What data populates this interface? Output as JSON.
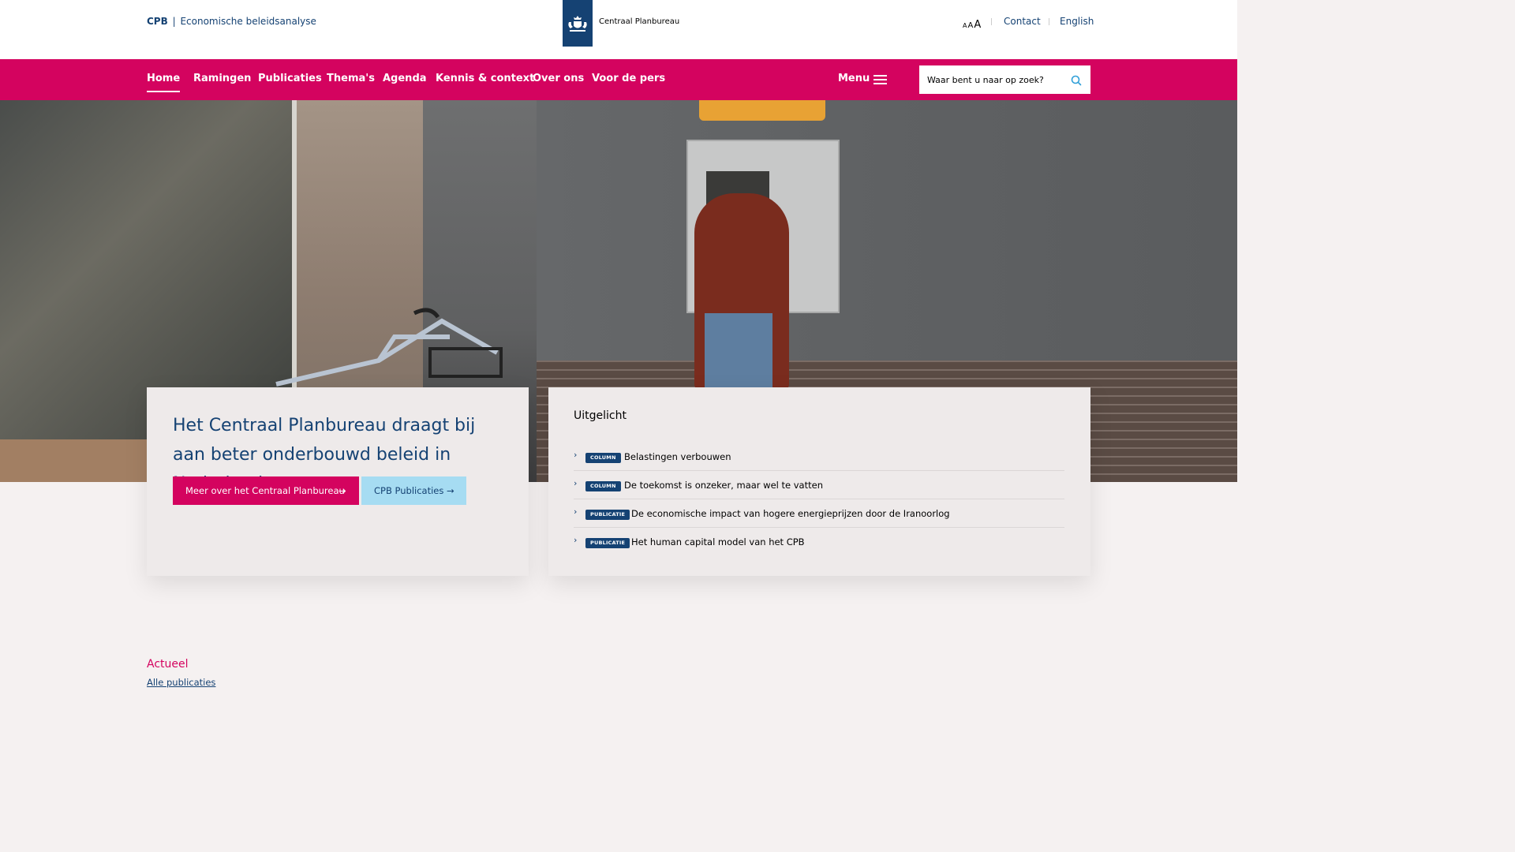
{
  "header": {
    "brand_short": "CPB",
    "brand_separator": "|",
    "brand_tagline": "Economische beleidsanalyse",
    "logo_text": "Centraal Planbureau",
    "font_size_labels": [
      "A",
      "A",
      "A"
    ],
    "contact_label": "Contact",
    "language_label": "English"
  },
  "nav": {
    "items": [
      {
        "label": "Home",
        "active": true
      },
      {
        "label": "Ramingen"
      },
      {
        "label": "Publicaties"
      },
      {
        "label": "Thema's"
      },
      {
        "label": "Agenda"
      },
      {
        "label": "Kennis & context"
      },
      {
        "label": "Over ons"
      },
      {
        "label": "Voor de pers"
      }
    ],
    "menu_label": "Menu",
    "search_placeholder": "Waar bent u naar op zoek?"
  },
  "intro": {
    "heading": "Het Centraal Planbureau draagt bij aan beter onderbouwd beleid in Nederland",
    "primary_button": "Meer over het Centraal Planbureau",
    "secondary_button": "CPB Publicaties",
    "arrow": "→"
  },
  "featured": {
    "title": "Uitgelicht",
    "items": [
      {
        "tag": "COLUMN",
        "title": "Belastingen verbouwen"
      },
      {
        "tag": "COLUMN",
        "title": "De toekomst is onzeker, maar wel te vatten"
      },
      {
        "tag": "PUBLICATIE",
        "title": "De economische impact van hogere energieprijzen door de Iranoorlog"
      },
      {
        "tag": "PUBLICATIE",
        "title": "Het human capital model van het CPB"
      }
    ]
  },
  "news": {
    "title": "Actueel",
    "all_link": "Alle publicaties"
  },
  "colors": {
    "brand_pink": "#d4035f",
    "brand_blue": "#154273",
    "light_blue": "#a6dcf2"
  },
  "icons": [
    "crest-logo-icon",
    "search-icon",
    "hamburger-menu-icon",
    "chevron-right-icon",
    "arrow-right-icon"
  ]
}
